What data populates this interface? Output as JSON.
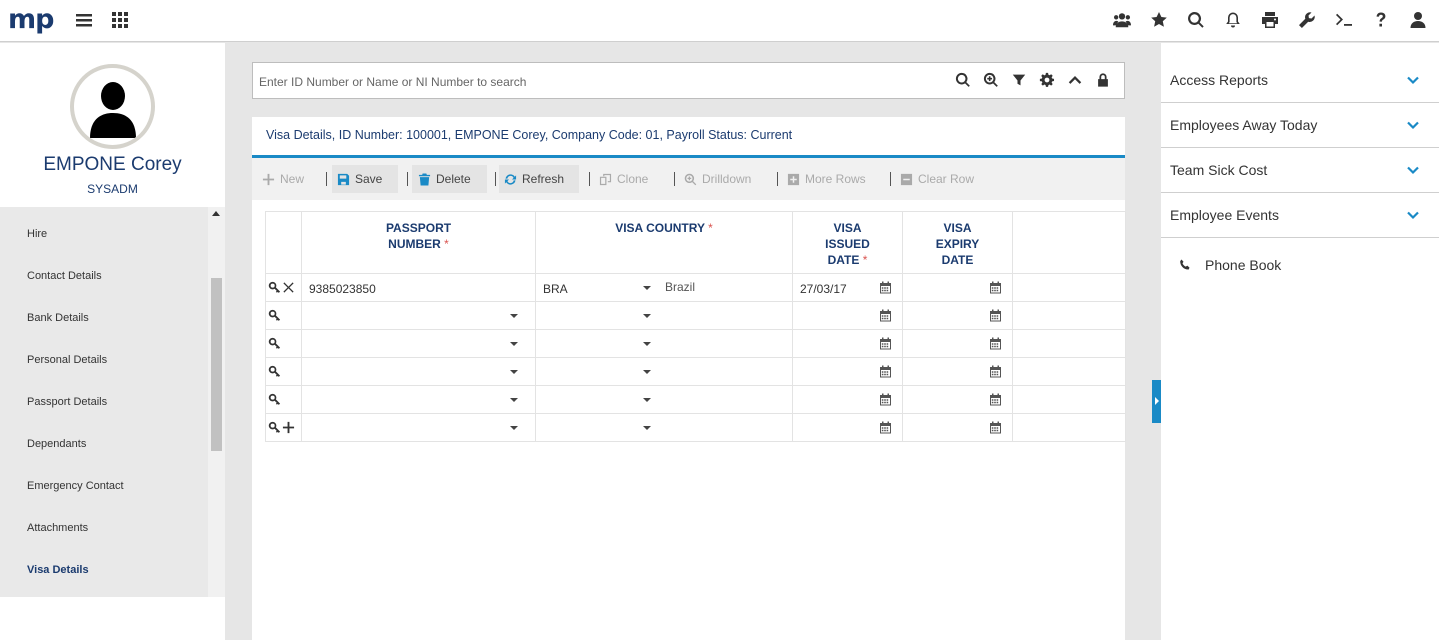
{
  "app": {
    "logo": "mp"
  },
  "employee": {
    "name": "EMPONE Corey",
    "role": "SYSADM"
  },
  "nav": {
    "items": [
      {
        "label": "Hire"
      },
      {
        "label": "Contact Details"
      },
      {
        "label": "Bank Details"
      },
      {
        "label": "Personal Details"
      },
      {
        "label": "Passport Details"
      },
      {
        "label": "Dependants"
      },
      {
        "label": "Emergency Contact"
      },
      {
        "label": "Attachments"
      },
      {
        "label": "Visa Details",
        "active": true
      }
    ]
  },
  "search": {
    "placeholder": "Enter ID Number or Name or NI Number to search"
  },
  "form": {
    "title": "Visa Details, ID Number: 100001, EMPONE Corey, Company Code: 01, Payroll Status: Current"
  },
  "toolbar": {
    "new": "New",
    "save": "Save",
    "delete": "Delete",
    "refresh": "Refresh",
    "clone": "Clone",
    "drilldown": "Drilldown",
    "more_rows": "More Rows",
    "clear_row": "Clear Row"
  },
  "grid": {
    "headers": {
      "passport_line1": "PASSPORT",
      "passport_line2": "NUMBER",
      "country": "VISA COUNTRY",
      "issued_line1": "VISA",
      "issued_line2": "ISSUED",
      "issued_line3": "DATE",
      "expiry_line1": "VISA",
      "expiry_line2": "EXPIRY",
      "expiry_line3": "DATE",
      "required_mark": "*"
    },
    "rows": [
      {
        "passport": "9385023850",
        "country_code": "BRA",
        "country_name": "Brazil",
        "issued": "27/03/17",
        "expiry": ""
      }
    ]
  },
  "right_panel": {
    "accordions": [
      "Access Reports",
      "Employees Away Today",
      "Team Sick Cost",
      "Employee Events"
    ],
    "phone_book": "Phone Book"
  },
  "colors": {
    "brand": "#1b3b6f",
    "accent": "#1a8ac6",
    "required": "#d9534f"
  }
}
